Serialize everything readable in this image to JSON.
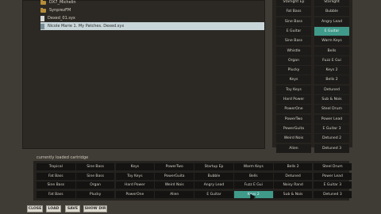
{
  "file_browser": {
    "items": [
      {
        "type": "folder",
        "label": "DX7_Michelin"
      },
      {
        "type": "folder",
        "label": "SynprezFM"
      },
      {
        "type": "file",
        "label": "Dexed_01.syx"
      },
      {
        "type": "file",
        "label": "Nicole Marie 1. My Patches. Dexed.syx",
        "selected": true
      }
    ]
  },
  "right_list": {
    "left": [
      "Starlight Ep",
      "Fat Bass",
      "Sine Bass",
      "E Guitar",
      "Sine Bass",
      "Whistle",
      "Organ",
      "Plucky",
      "Keys",
      "Toy Keys",
      "Hard Power",
      "PowerOne",
      "PowerTwo",
      "PowerGuita",
      "Weird Nois",
      "Alien"
    ],
    "right": [
      "Starlight",
      "Bubble",
      "Angry Lead",
      "E Guitar",
      "Warm Keys",
      "Bells",
      "Fuzz E Gui",
      "Keys 2",
      "Bells 2",
      "Detuned",
      "Sub & Nois",
      "Steel Drum",
      "Power Lead",
      "E Guitar 3",
      "Detuned 2",
      "Detuned 3"
    ],
    "active_right": 3
  },
  "cartridge": {
    "label": "currently loaded cartridge",
    "rows": [
      [
        "Tropical",
        "Sine Bass",
        "Keys",
        "PowerTwo",
        "Startup Ep",
        "Warm Keys",
        "Bells 2",
        "Steel Drum"
      ],
      [
        "Fat Bass",
        "Sine Bass",
        "Toy Keys",
        "PowerGuita",
        "Bubble",
        "Bells",
        "Detuned",
        "Power Lead"
      ],
      [
        "Sine Bass",
        "Organ",
        "Hard Power",
        "Weird Nois",
        "Angry Lead",
        "Fuzz E Gui",
        "Noisy Rand",
        "E Guitar 3"
      ],
      [
        "Fat Bass",
        "Plucky",
        "PowerOne",
        "Alien",
        "E Guitar",
        "Keys 2",
        "Sub & Nois",
        "Detuned 3"
      ]
    ],
    "active": [
      3,
      5
    ]
  },
  "buttons": {
    "close": "CLOSE",
    "load": "LOAD",
    "save": "SAVE",
    "show_dir": "SHOW DIR"
  }
}
